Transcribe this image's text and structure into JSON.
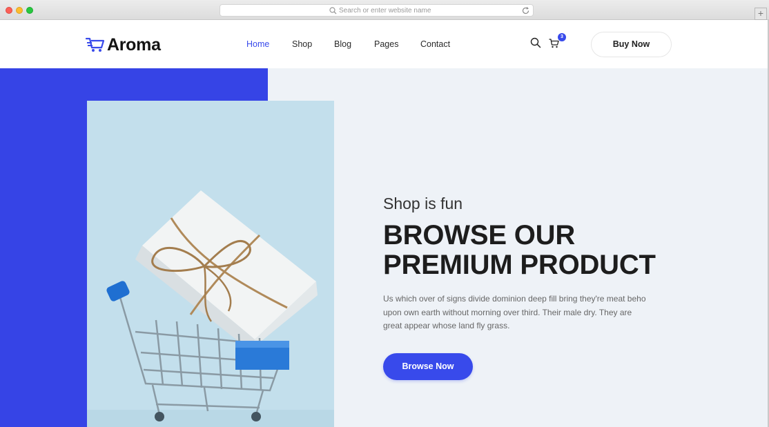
{
  "browser": {
    "url_placeholder": "Search or enter website name",
    "new_tab_label": "+"
  },
  "header": {
    "logo_text": "Aroma",
    "nav": [
      {
        "label": "Home",
        "active": true
      },
      {
        "label": "Shop",
        "active": false
      },
      {
        "label": "Blog",
        "active": false
      },
      {
        "label": "Pages",
        "active": false
      },
      {
        "label": "Contact",
        "active": false
      }
    ],
    "cart_count": "3",
    "buy_label": "Buy Now"
  },
  "hero": {
    "subtitle": "Shop is fun",
    "headline_line1": "BROWSE OUR",
    "headline_line2": "PREMIUM PRODUCT",
    "description": "Us which over of signs divide dominion deep fill bring they're meat beho upon own earth without morning over third. Their male dry. They are great appear whose land fly grass.",
    "cta_label": "Browse Now"
  },
  "colors": {
    "accent": "#384aeb",
    "hero_blue": "#3644e6",
    "hero_bg": "#eef2f7",
    "image_bg": "#c3dfec"
  },
  "icons": {
    "logo": "shopping-cart-icon",
    "search": "search-icon",
    "cart": "cart-icon",
    "reload": "reload-icon"
  }
}
